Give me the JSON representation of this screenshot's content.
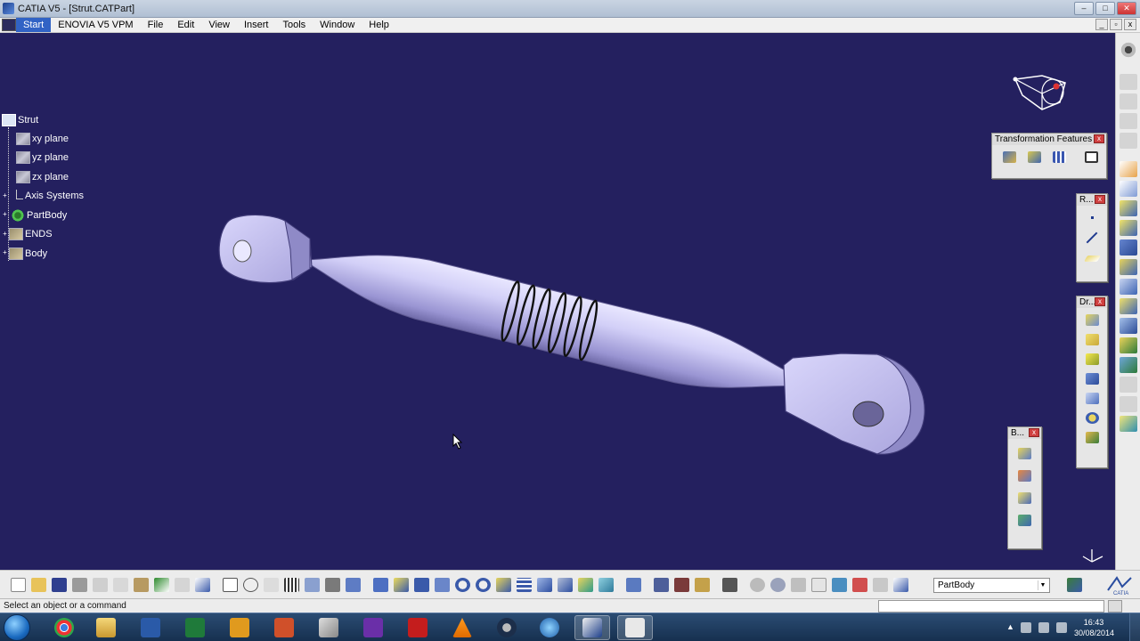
{
  "window": {
    "title": "CATIA V5 - [Strut.CATPart]"
  },
  "menu": {
    "items": [
      "Start",
      "ENOVIA V5 VPM",
      "File",
      "Edit",
      "View",
      "Insert",
      "Tools",
      "Window",
      "Help"
    ]
  },
  "tree": {
    "root": "Strut",
    "nodes": [
      {
        "label": "xy plane",
        "icon": "plane-icon"
      },
      {
        "label": "yz plane",
        "icon": "plane-icon"
      },
      {
        "label": "zx plane",
        "icon": "plane-icon"
      },
      {
        "label": "Axis Systems",
        "icon": "axis-system-icon"
      },
      {
        "label": "PartBody",
        "icon": "partbody-gear-icon"
      },
      {
        "label": "ENDS",
        "icon": "body-icon"
      },
      {
        "label": "Body",
        "icon": "body-icon"
      }
    ]
  },
  "toolbars": {
    "transformation": {
      "title": "Transformation Features"
    },
    "reference": {
      "title": "R..."
    },
    "dress": {
      "title": "Dr..."
    },
    "boolean": {
      "title": "B..."
    }
  },
  "bottom": {
    "current_body": "PartBody"
  },
  "status": {
    "message": "Select an object or a command"
  },
  "taskbar": {
    "time": "16:43",
    "date": "30/08/2014"
  },
  "colors": {
    "viewport_bg": "#24205f",
    "part_color": "#b9b4e8",
    "menu_highlight": "#3163c5"
  }
}
